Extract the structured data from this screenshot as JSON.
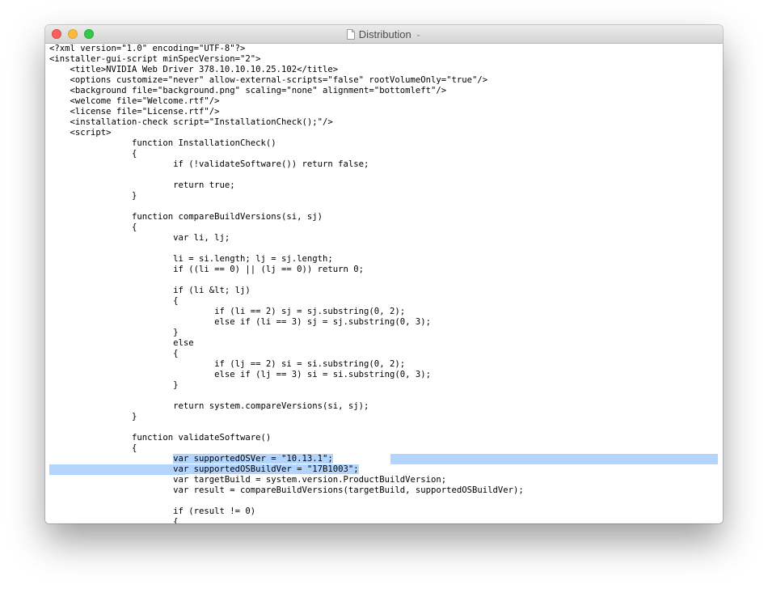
{
  "window": {
    "title": "Distribution",
    "title_chevron": "⌄",
    "selection_color": "#b3d4fd"
  },
  "editor": {
    "lines": [
      "<?xml version=\"1.0\" encoding=\"UTF-8\"?>",
      "<installer-gui-script minSpecVersion=\"2\">",
      "    <title>NVIDIA Web Driver 378.10.10.10.25.102</title>",
      "    <options customize=\"never\" allow-external-scripts=\"false\" rootVolumeOnly=\"true\"/>",
      "    <background file=\"background.png\" scaling=\"none\" alignment=\"bottomleft\"/>",
      "    <welcome file=\"Welcome.rtf\"/>",
      "    <license file=\"License.rtf\"/>",
      "    <installation-check script=\"InstallationCheck();\"/>",
      "    <script>",
      "                function InstallationCheck()",
      "                {",
      "                        if (!validateSoftware()) return false;",
      "",
      "                        return true;",
      "                }",
      "",
      "                function compareBuildVersions(si, sj)",
      "                {",
      "                        var li, lj;",
      "",
      "                        li = si.length; lj = sj.length;",
      "                        if ((li == 0) || (lj == 0)) return 0;",
      "",
      "                        if (li &lt; lj)",
      "                        {",
      "                                if (li == 2) sj = sj.substring(0, 2);",
      "                                else if (li == 3) sj = sj.substring(0, 3);",
      "                        }",
      "                        else",
      "                        {",
      "                                if (lj == 2) si = si.substring(0, 2);",
      "                                else if (lj == 3) si = si.substring(0, 3);",
      "                        }",
      "",
      "                        return system.compareVersions(si, sj);",
      "                }",
      "",
      "                function validateSoftware()",
      "                {",
      "                        var supportedOSVer = \"10.13.1\";",
      "                        var supportedOSBuildVer = \"17B1003\";",
      "                        var targetBuild = system.version.ProductBuildVersion;",
      "                        var result = compareBuildVersions(targetBuild, supportedOSBuildVer);",
      "",
      "                        if (result != 0)",
      "                        {"
    ]
  }
}
